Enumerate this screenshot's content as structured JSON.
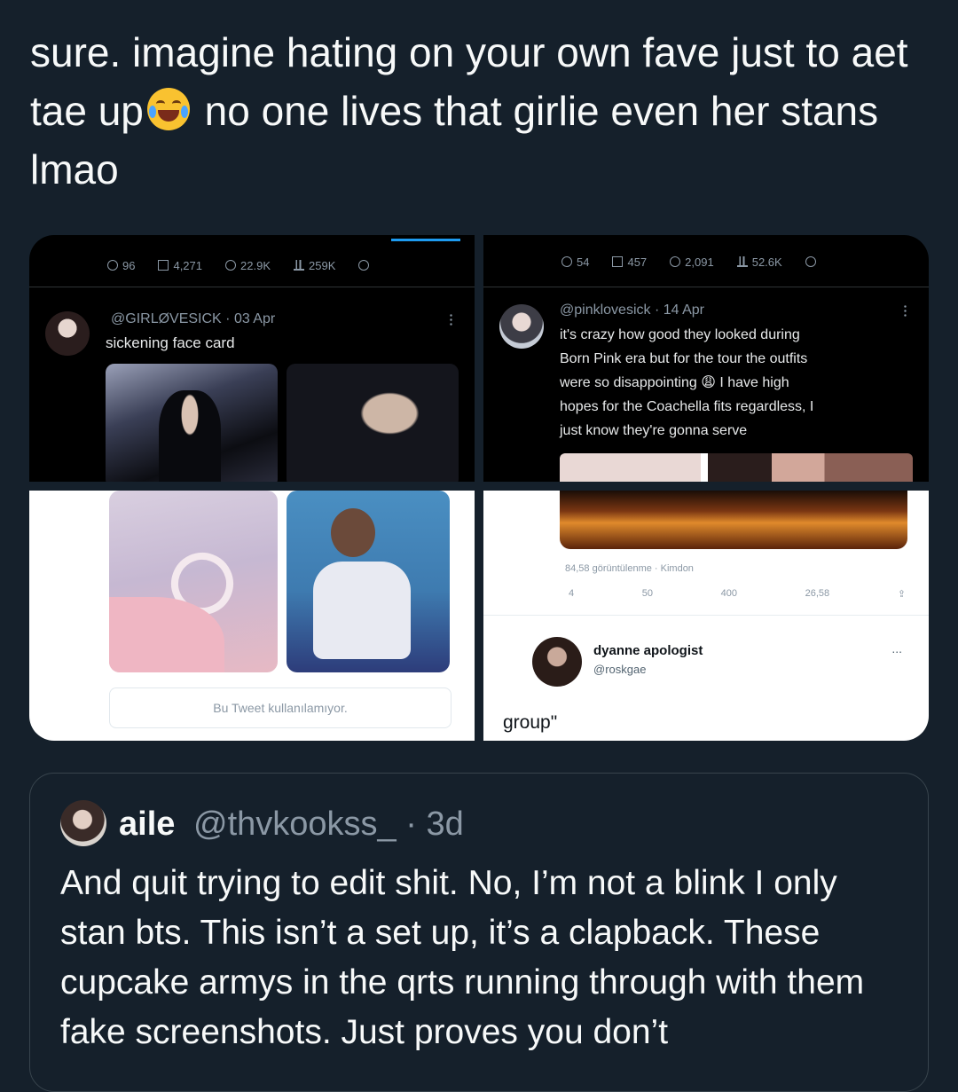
{
  "tweet": {
    "text_part1": "sure. imagine hating on your own fave just to aet tae up",
    "text_part2": " no one lives that girlie even her stans lmao",
    "emoji": "face-with-tears-of-joy"
  },
  "media": {
    "shot1": {
      "stats": {
        "replies": "96",
        "retweets": "4,271",
        "likes": "22.9K",
        "views": "259K"
      },
      "handle": "@GIRLØVESICK · 03 Apr",
      "text": "sickening face card"
    },
    "shot2": {
      "stats": {
        "replies": "54",
        "retweets": "457",
        "likes": "2,091",
        "views": "52.6K"
      },
      "handle": "@pinklovesick · 14 Apr",
      "text_lines": [
        "it's crazy how good they looked during",
        "Born Pink era but for the tour the outfits",
        "were so disappointing 😩 I have high",
        "hopes for the Coachella fits regardless, I",
        "just know they're gonna serve"
      ]
    },
    "shot3": {
      "notice": "Bu Tweet kullanılamıyor."
    },
    "shot4": {
      "meta": "84,58 görüntülenme · Kimdon",
      "actions": {
        "replies": "4",
        "retweets": "50",
        "likes": "400",
        "views": "26,58"
      },
      "user_name": "dyanne apologist",
      "user_handle": "@roskgae",
      "more": "...",
      "trailing_text": "group\""
    }
  },
  "quote": {
    "name": "aile",
    "handle_time": "@thvkookss_ · 3d",
    "text": "And quit trying to edit shit. No, I’m not a blink I only stan bts. This isn’t a set up, it’s a clapback. These cupcake armys in the qrts running through with them fake screenshots. Just proves you don’t"
  },
  "colors": {
    "background": "#15202b",
    "text": "#f7f9f9",
    "secondary_text": "#8b98a5",
    "border": "#38444d",
    "accent": "#1d9bf0"
  }
}
